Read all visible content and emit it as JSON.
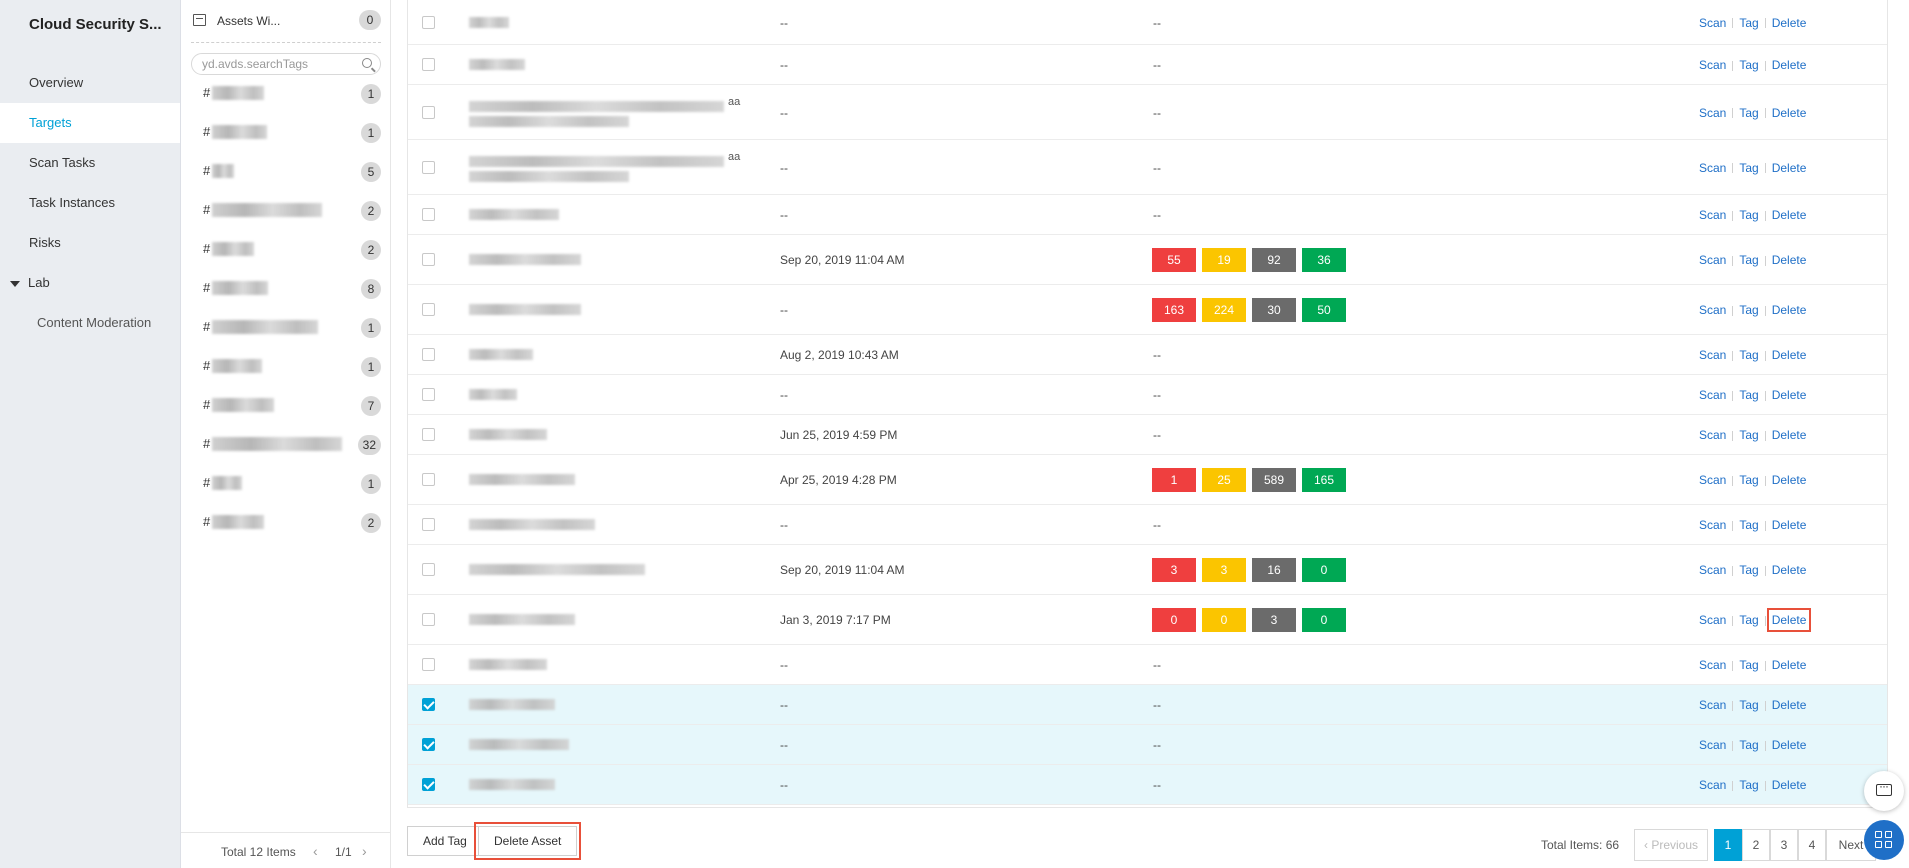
{
  "nav": {
    "app_title": "Cloud Security S...",
    "items": [
      {
        "label": "Overview"
      },
      {
        "label": "Targets"
      },
      {
        "label": "Scan Tasks"
      },
      {
        "label": "Task Instances"
      },
      {
        "label": "Risks"
      }
    ],
    "group": {
      "label": "Lab",
      "items": [
        {
          "label": "Content Moderation"
        }
      ]
    }
  },
  "tags": {
    "header_title": "Assets Wi...",
    "header_count": "0",
    "search_placeholder": "yd.avds.searchTags",
    "items": [
      {
        "count": "1"
      },
      {
        "count": "1"
      },
      {
        "count": "5"
      },
      {
        "count": "2"
      },
      {
        "count": "2"
      },
      {
        "count": "8"
      },
      {
        "count": "1"
      },
      {
        "count": "1"
      },
      {
        "count": "7"
      },
      {
        "count": "32"
      },
      {
        "count": "1"
      },
      {
        "count": "2"
      }
    ],
    "tag_prefix": "#",
    "footer_total": "Total 12 Items",
    "footer_page": "1/1"
  },
  "table": {
    "ops": {
      "scan": "Scan",
      "tag": "Tag",
      "delete": "Delete"
    },
    "rows": [
      {
        "time": "--",
        "risk": "--",
        "checked": false
      },
      {
        "time": "--",
        "risk": "--",
        "checked": false
      },
      {
        "time": "--",
        "risk": "--",
        "checked": false,
        "suffix": "aa"
      },
      {
        "time": "--",
        "risk": "--",
        "checked": false,
        "suffix": "aa"
      },
      {
        "time": "--",
        "risk": "--",
        "checked": false
      },
      {
        "time": "Sep 20, 2019 11:04 AM",
        "risk": [
          "55",
          "19",
          "92",
          "36"
        ],
        "checked": false
      },
      {
        "time": "--",
        "risk": [
          "163",
          "224",
          "30",
          "50"
        ],
        "checked": false
      },
      {
        "time": "Aug 2, 2019 10:43 AM",
        "risk": "--",
        "checked": false
      },
      {
        "time": "--",
        "risk": "--",
        "checked": false
      },
      {
        "time": "Jun 25, 2019 4:59 PM",
        "risk": "--",
        "checked": false
      },
      {
        "time": "Apr 25, 2019 4:28 PM",
        "risk": [
          "1",
          "25",
          "589",
          "165"
        ],
        "checked": false
      },
      {
        "time": "--",
        "risk": "--",
        "checked": false
      },
      {
        "time": "Sep 20, 2019 11:04 AM",
        "risk": [
          "3",
          "3",
          "16",
          "0"
        ],
        "checked": false
      },
      {
        "time": "Jan 3, 2019 7:17 PM",
        "risk": [
          "0",
          "0",
          "3",
          "0"
        ],
        "checked": false,
        "delete_highlighted": true
      },
      {
        "time": "--",
        "risk": "--",
        "checked": false
      },
      {
        "time": "--",
        "risk": "--",
        "checked": true
      },
      {
        "time": "--",
        "risk": "--",
        "checked": true
      },
      {
        "time": "--",
        "risk": "--",
        "checked": true
      }
    ]
  },
  "footer": {
    "add_tag": "Add Tag",
    "delete_asset": "Delete Asset",
    "total_items": "Total Items: 66",
    "previous": "Previous",
    "pages": [
      "1",
      "2",
      "3",
      "4"
    ],
    "next": "Next"
  },
  "colors": {
    "accent": "#00a1d6",
    "link": "#1f6fc7",
    "critical": "#ef3f3f",
    "high": "#fbc500",
    "medium": "#6b6b6b",
    "low": "#00a854",
    "highlight_box": "#e8503a"
  }
}
